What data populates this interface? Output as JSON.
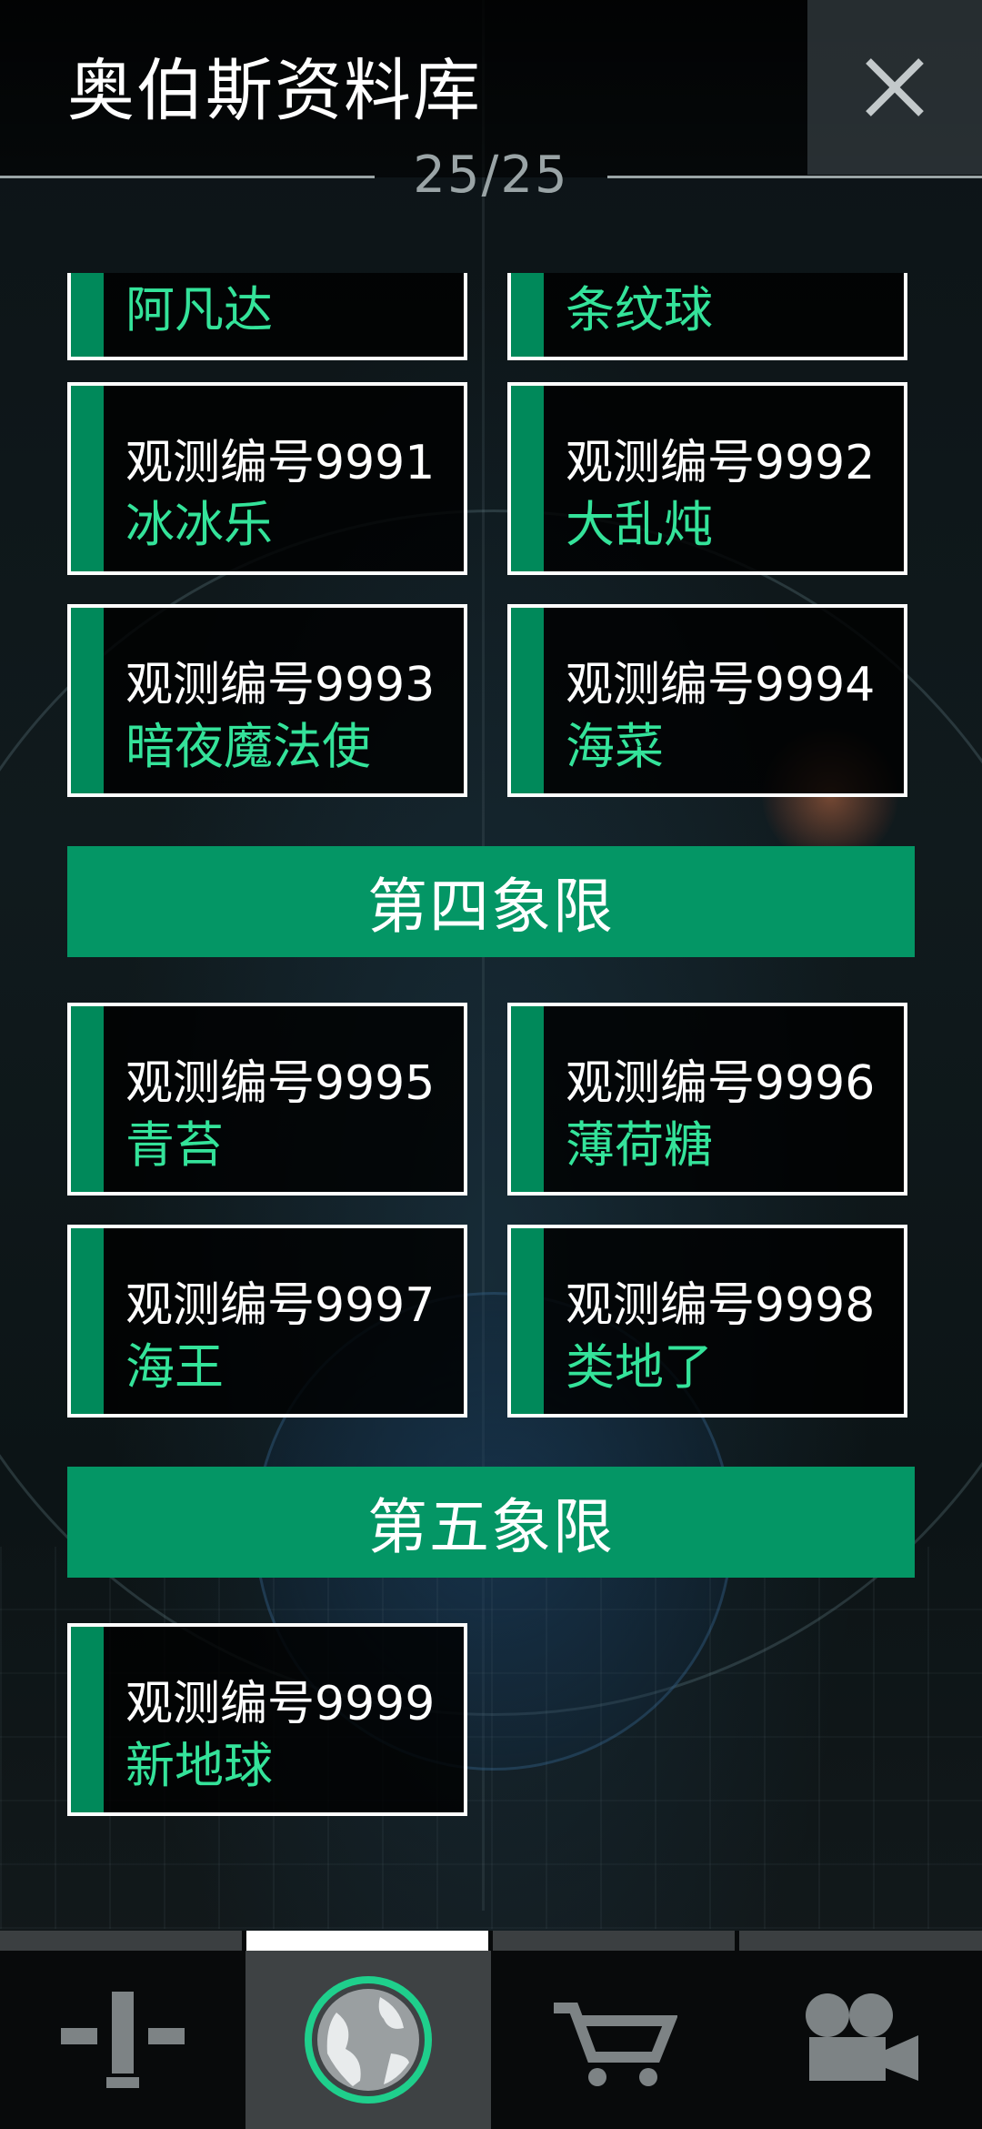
{
  "header": {
    "title": "奥伯斯资料库",
    "counter": "25/25",
    "close_icon": "close-icon"
  },
  "partial_cards": [
    {
      "name": "阿凡达"
    },
    {
      "name": "条纹球"
    }
  ],
  "cards": [
    {
      "num": "观测编号9991",
      "name": "冰冰乐"
    },
    {
      "num": "观测编号9992",
      "name": "大乱炖"
    },
    {
      "num": "观测编号9993",
      "name": "暗夜魔法使"
    },
    {
      "num": "观测编号9994",
      "name": "海菜"
    },
    {
      "num": "观测编号9995",
      "name": "青苔"
    },
    {
      "num": "观测编号9996",
      "name": "薄荷糖"
    },
    {
      "num": "观测编号9997",
      "name": "海王"
    },
    {
      "num": "观测编号9998",
      "name": "类地了"
    },
    {
      "num": "观测编号9999",
      "name": "新地球"
    }
  ],
  "sections": [
    {
      "label": "第四象限"
    },
    {
      "label": "第五象限"
    }
  ],
  "colors": {
    "accent": "#049665",
    "name_text": "#34e39a",
    "stripe": "#00895a"
  },
  "nav": {
    "active_index": 1,
    "tabs": [
      {
        "icon": "tools-icon"
      },
      {
        "icon": "planet-icon"
      },
      {
        "icon": "cart-icon"
      },
      {
        "icon": "video-camera-icon"
      }
    ]
  }
}
